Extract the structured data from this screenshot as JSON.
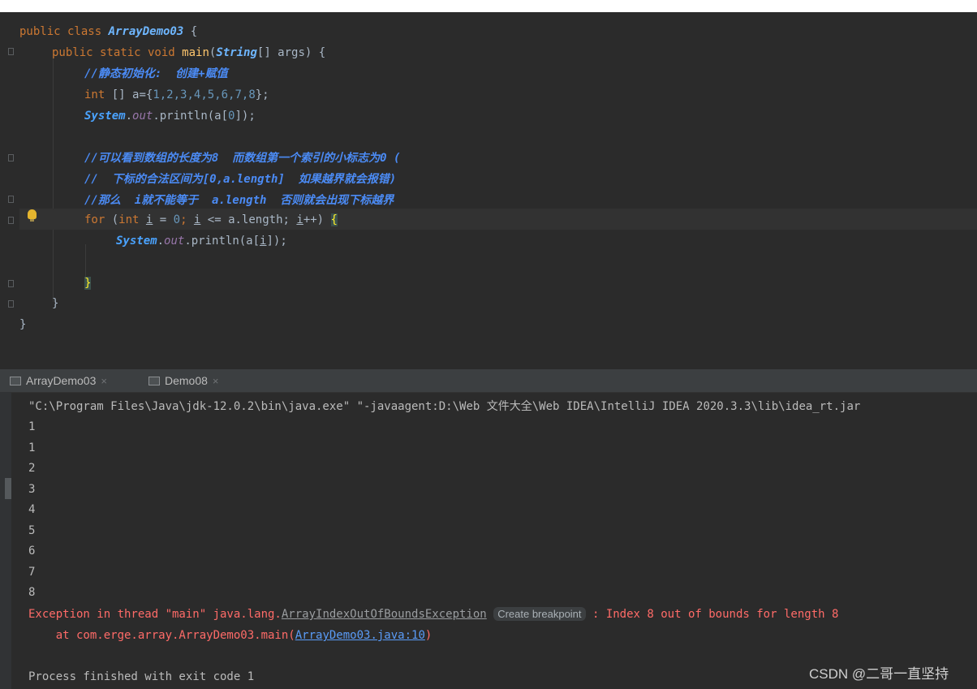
{
  "editor": {
    "line1": {
      "kw": "public class ",
      "cls": "ArrayDemo03",
      "rest": " {"
    },
    "line2": {
      "kw": "public static void ",
      "fn": "main",
      "p1": "(",
      "type": "String",
      "p2": "[] args) {"
    },
    "line3": {
      "comment": "//静态初始化:  创建+赋值"
    },
    "line4": {
      "kw": "int",
      "p1": " [] a={",
      "nums": "1,2,3,4,5,6,7,8",
      "p2": "};"
    },
    "line5": {
      "sys": "System",
      "dot1": ".",
      "field": "out",
      "rest": ".println(a[",
      "num": "0",
      "end": "]);"
    },
    "line6": {
      "comment": "//可以看到数组的长度为8  而数组第一个索引的小标志为0 ("
    },
    "line7": {
      "comment": "//  下标的合法区间为[0,a.length]  如果越界就会报错)"
    },
    "line8": {
      "comment": "//那么  i就不能等于  a.length  否则就会出现下标越界"
    },
    "line9": {
      "kw": "for",
      "p1": " (",
      "kw2": "int",
      "sp": " ",
      "var1": "i",
      "p2": " = ",
      "num": "0",
      "semi1": "; ",
      "var2": "i",
      "p3": " <= a.length; ",
      "var3": "i",
      "p4": "++) ",
      "brace": "{"
    },
    "line10": {
      "sys": "System",
      "dot1": ".",
      "field": "out",
      "rest": ".println(a[",
      "var": "i",
      "end": "]);"
    },
    "line11": {
      "brace": "}"
    },
    "line12": {
      "brace": "}"
    },
    "line13": {
      "brace": "}"
    }
  },
  "tabs": [
    {
      "label": "ArrayDemo03",
      "close": "×"
    },
    {
      "label": "Demo08",
      "close": "×"
    }
  ],
  "console": {
    "command": "\"C:\\Program Files\\Java\\jdk-12.0.2\\bin\\java.exe\" \"-javaagent:D:\\Web 文件大全\\Web IDEA\\IntelliJ IDEA 2020.3.3\\lib\\idea_rt.jar",
    "outputs": [
      "1",
      "1",
      "2",
      "3",
      "4",
      "5",
      "6",
      "7",
      "8"
    ],
    "exception_prefix": "Exception in thread \"main\" java.lang.",
    "exception_class": "ArrayIndexOutOfBoundsException",
    "create_breakpoint": "Create breakpoint",
    "exception_suffix": ": Index 8 out of bounds for length 8",
    "stack_prefix": "    at com.erge.array.ArrayDemo03.main(",
    "stack_link": "ArrayDemo03.java:10",
    "stack_suffix": ")",
    "finished": "Process finished with exit code 1"
  },
  "watermark": "CSDN @二哥一直坚持",
  "colors": {
    "editor_bg": "#2b2b2b",
    "keyword": "#cc7832",
    "comment": "#4b8bf5",
    "error": "#ff6b68",
    "link": "#5a9cf8"
  }
}
